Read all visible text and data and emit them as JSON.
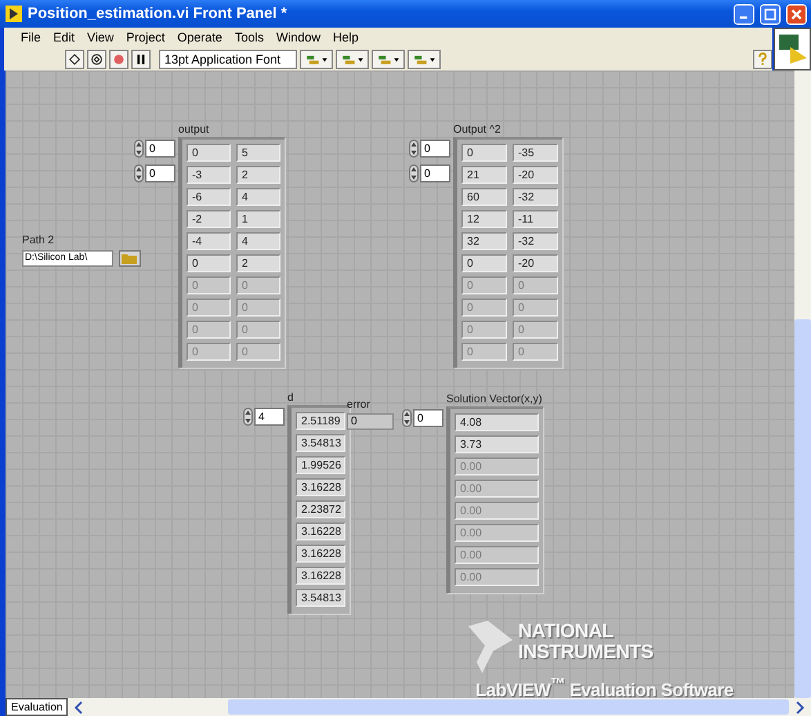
{
  "window": {
    "title": "Position_estimation.vi Front Panel *"
  },
  "menu": [
    "File",
    "Edit",
    "View",
    "Project",
    "Operate",
    "Tools",
    "Window",
    "Help"
  ],
  "toolbar": {
    "font": "13pt Application Font"
  },
  "path_control": {
    "label": "Path 2",
    "value": "D:\\Silicon Lab\\"
  },
  "controls": [
    {
      "kind": "array",
      "label": "output",
      "indices": [
        "0",
        "0"
      ],
      "rows": [
        {
          "values": [
            "0",
            "5"
          ],
          "disabled": false
        },
        {
          "values": [
            "-3",
            "2"
          ],
          "disabled": false
        },
        {
          "values": [
            "-6",
            "4"
          ],
          "disabled": false
        },
        {
          "values": [
            "-2",
            "1"
          ],
          "disabled": false
        },
        {
          "values": [
            "-4",
            "4"
          ],
          "disabled": false
        },
        {
          "values": [
            "0",
            "2"
          ],
          "disabled": false
        },
        {
          "values": [
            "0",
            "0"
          ],
          "disabled": true
        },
        {
          "values": [
            "0",
            "0"
          ],
          "disabled": true
        },
        {
          "values": [
            "0",
            "0"
          ],
          "disabled": true
        },
        {
          "values": [
            "0",
            "0"
          ],
          "disabled": true
        }
      ]
    },
    {
      "kind": "array",
      "label": "Output ^2",
      "indices": [
        "0",
        "0"
      ],
      "rows": [
        {
          "values": [
            "0",
            "-35"
          ],
          "disabled": false
        },
        {
          "values": [
            "21",
            "-20"
          ],
          "disabled": false
        },
        {
          "values": [
            "60",
            "-32"
          ],
          "disabled": false
        },
        {
          "values": [
            "12",
            "-11"
          ],
          "disabled": false
        },
        {
          "values": [
            "32",
            "-32"
          ],
          "disabled": false
        },
        {
          "values": [
            "0",
            "-20"
          ],
          "disabled": false
        },
        {
          "values": [
            "0",
            "0"
          ],
          "disabled": true
        },
        {
          "values": [
            "0",
            "0"
          ],
          "disabled": true
        },
        {
          "values": [
            "0",
            "0"
          ],
          "disabled": true
        },
        {
          "values": [
            "0",
            "0"
          ],
          "disabled": true
        }
      ]
    },
    {
      "kind": "array",
      "label": "d",
      "indices": [
        "4"
      ],
      "rows": [
        {
          "values": [
            "2.51189"
          ],
          "disabled": false
        },
        {
          "values": [
            "3.54813"
          ],
          "disabled": false
        },
        {
          "values": [
            "1.99526"
          ],
          "disabled": false
        },
        {
          "values": [
            "3.16228"
          ],
          "disabled": false
        },
        {
          "values": [
            "2.23872"
          ],
          "disabled": false
        },
        {
          "values": [
            "3.16228"
          ],
          "disabled": false
        },
        {
          "values": [
            "3.16228"
          ],
          "disabled": false
        },
        {
          "values": [
            "3.16228"
          ],
          "disabled": false
        },
        {
          "values": [
            "3.54813"
          ],
          "disabled": false
        }
      ]
    },
    {
      "kind": "numeric",
      "label": "error",
      "value": "0"
    },
    {
      "kind": "array",
      "label": "Solution Vector(x,y)",
      "indices": [
        "0"
      ],
      "rows": [
        {
          "values": [
            "4.08"
          ],
          "disabled": false
        },
        {
          "values": [
            "3.73"
          ],
          "disabled": false
        },
        {
          "values": [
            "0.00"
          ],
          "disabled": true
        },
        {
          "values": [
            "0.00"
          ],
          "disabled": true
        },
        {
          "values": [
            "0.00"
          ],
          "disabled": true
        },
        {
          "values": [
            "0.00"
          ],
          "disabled": true
        },
        {
          "values": [
            "0.00"
          ],
          "disabled": true
        },
        {
          "values": [
            "0.00"
          ],
          "disabled": true
        }
      ]
    }
  ],
  "watermark": {
    "brand": [
      "NATIONAL",
      "INSTRUMENTS"
    ],
    "product": "LabVIEW$^{™}$ Evaluation Software"
  },
  "status_bar": {
    "tab": "Evaluation"
  }
}
